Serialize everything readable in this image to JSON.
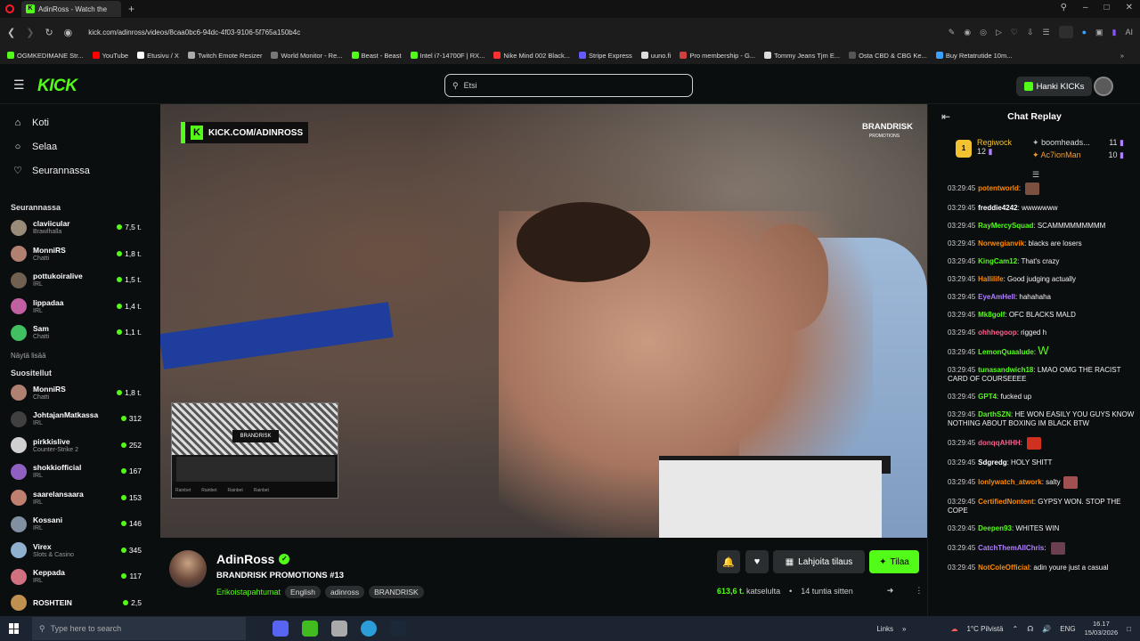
{
  "browser": {
    "tab_title": "AdinRoss - Watch the",
    "url": "kick.com/adinross/videos/8caa0bc6-94dc-4f03-9106-5f765a150b4c",
    "toolbar_ai": "AI",
    "bookmarks": [
      {
        "label": "OGMKEDIMANE Str...",
        "color": "#53fc18"
      },
      {
        "label": "YouTube",
        "color": "#ff0000"
      },
      {
        "label": "Etusivu / X",
        "color": "#ffffff"
      },
      {
        "label": "Twitch Emote Resizer",
        "color": "#aaaaaa"
      },
      {
        "label": "World Monitor - Re...",
        "color": "#777777"
      },
      {
        "label": "Beast - Beast",
        "color": "#53fc18"
      },
      {
        "label": "Intel i7-14700F | RX...",
        "color": "#53fc18"
      },
      {
        "label": "Nike Mind 002 Black...",
        "color": "#ff3030"
      },
      {
        "label": "Stripe Express",
        "color": "#635bff"
      },
      {
        "label": "uuno.fi",
        "color": "#dddddd"
      },
      {
        "label": "Pro membership - G...",
        "color": "#d04040"
      },
      {
        "label": "Tommy Jeans Tjm E...",
        "color": "#dddddd"
      },
      {
        "label": "Osta CBD & CBG Ke...",
        "color": "#555555"
      },
      {
        "label": "Buy Retatrutide 10m...",
        "color": "#3ca0ff"
      }
    ]
  },
  "header": {
    "logo": "KICK",
    "search_placeholder": "Etsi",
    "get_kicks": "Hanki KICKs"
  },
  "sidebar": {
    "nav": [
      {
        "label": "Koti",
        "icon": "home-icon"
      },
      {
        "label": "Selaa",
        "icon": "compass-icon"
      },
      {
        "label": "Seurannassa",
        "icon": "heart-icon"
      }
    ],
    "following_title": "Seurannassa",
    "following": [
      {
        "name": "claviicular",
        "game": "Brawlhalla",
        "viewers": "7,5 t.",
        "color": "#9a8a7a"
      },
      {
        "name": "MonniRS",
        "game": "Chatti",
        "viewers": "1,8 t.",
        "color": "#b08070"
      },
      {
        "name": "pottukoiralive",
        "game": "IRL",
        "viewers": "1,5 t.",
        "color": "#706050"
      },
      {
        "name": "lippadaa",
        "game": "IRL",
        "viewers": "1,4 t.",
        "color": "#c060a0"
      },
      {
        "name": "Sam",
        "game": "Chatti",
        "viewers": "1,1 t.",
        "color": "#40c060"
      }
    ],
    "show_more": "Näytä lisää",
    "recommended_title": "Suositellut",
    "recommended": [
      {
        "name": "MonniRS",
        "game": "Chatti",
        "viewers": "1,8 t.",
        "color": "#b08070"
      },
      {
        "name": "JohtajanMatkassa",
        "game": "IRL",
        "viewers": "312",
        "color": "#404040"
      },
      {
        "name": "pirkkislive",
        "game": "Counter-Strike 2",
        "viewers": "252",
        "color": "#d0d0d0"
      },
      {
        "name": "shokkiofficial",
        "game": "IRL",
        "viewers": "167",
        "color": "#9060c0"
      },
      {
        "name": "saarelansaara",
        "game": "IRL",
        "viewers": "153",
        "color": "#c08070"
      },
      {
        "name": "Kossani",
        "game": "IRL",
        "viewers": "146",
        "color": "#8090a0"
      },
      {
        "name": "Virex",
        "game": "Slots & Casino",
        "viewers": "345",
        "color": "#90b0d0"
      },
      {
        "name": "Keppada",
        "game": "IRL",
        "viewers": "117",
        "color": "#d07080"
      },
      {
        "name": "ROSHTEIN",
        "game": "",
        "viewers": "2,5",
        "color": "#c09050"
      }
    ]
  },
  "video": {
    "overlay_channel": "KICK.COM/ADINROSS",
    "overlay_brand": "BRANDRISK",
    "overlay_brand_sub": "PROMOTIONS",
    "pip_title": "BRANDRISK",
    "pip_sponsor": "Rainbet"
  },
  "stream": {
    "streamer": "AdinRoss",
    "title": "BRANDRISK PROMOTIONS #13",
    "category": "Erikoistapahtumat",
    "tags": [
      "English",
      "adinross",
      "BRANDRISK"
    ],
    "gift_sub": "Lahjoita tilaus",
    "subscribe": "Tilaa",
    "views": "613,6 t.",
    "views_label": "katselulta",
    "time_ago": "14 tuntia sitten"
  },
  "chat": {
    "title": "Chat Replay",
    "top_gifters": [
      {
        "name": "Regiwock",
        "count": "12"
      },
      {
        "name": "boomheads...",
        "count": "11"
      },
      {
        "name": "Ac7ionMan",
        "count": "10"
      }
    ],
    "messages": [
      {
        "time": "03:29:45",
        "user": "potentworld",
        "color": "#ff8a00",
        "text": "",
        "emote": "#7a5040"
      },
      {
        "time": "03:29:45",
        "user": "freddie4242",
        "color": "#ffffff",
        "text": "wwwwwww"
      },
      {
        "time": "03:29:45",
        "user": "RayMercySquad",
        "color": "#53fc18",
        "text": "SCAMMMMMMMMM"
      },
      {
        "time": "03:29:45",
        "user": "Norwegianvik",
        "color": "#ff8a00",
        "text": "blacks are losers"
      },
      {
        "time": "03:29:45",
        "user": "KingCam12",
        "color": "#53fc18",
        "text": "That's crazy"
      },
      {
        "time": "03:29:45",
        "user": "Hallilife",
        "color": "#ff8a00",
        "text": "Good judging actually"
      },
      {
        "time": "03:29:45",
        "user": "EyeAmHell",
        "color": "#b080ff",
        "text": "hahahaha"
      },
      {
        "time": "03:29:45",
        "user": "Mk8golf",
        "color": "#53fc18",
        "text": "OFC BLACKS MALD"
      },
      {
        "time": "03:29:45",
        "user": "ohhhegoop",
        "color": "#ff5c8a",
        "text": "rigged h"
      },
      {
        "time": "03:29:45",
        "user": "LemonQuaalude",
        "color": "#53fc18",
        "text": "W"
      },
      {
        "time": "03:29:45",
        "user": "tunasandwich18",
        "color": "#53fc18",
        "text": "LMAO OMG THE RACIST CARD OF COURSEEEE"
      },
      {
        "time": "03:29:45",
        "user": "GPT4",
        "color": "#53fc18",
        "text": "fucked up"
      },
      {
        "time": "03:29:45",
        "user": "DarthSZN",
        "color": "#53fc18",
        "text": "HE WON EASILY YOU GUYS KNOW NOTHING ABOUT BOXING IM BLACK BTW"
      },
      {
        "time": "03:29:45",
        "user": "donqqAHHH",
        "color": "#ff5c8a",
        "text": "",
        "emote": "#d03020"
      },
      {
        "time": "03:29:45",
        "user": "Sdgredg",
        "color": "#ffffff",
        "text": "HOLY SHITT"
      },
      {
        "time": "03:29:45",
        "user": "lonlywatch_atwork",
        "color": "#ff8a00",
        "text": "salty",
        "emote": "#a05050"
      },
      {
        "time": "03:29:45",
        "user": "CertifiedNontent",
        "color": "#ff8a00",
        "text": "GYPSY WON. STOP THE COPE"
      },
      {
        "time": "03:29:45",
        "user": "Deepen93",
        "color": "#53fc18",
        "text": "WHITES WIN"
      },
      {
        "time": "03:29:45",
        "user": "CatchThemAllChris",
        "color": "#b080ff",
        "text": "",
        "emote": "#6a4050"
      },
      {
        "time": "03:29:45",
        "user": "NotColeOfficial",
        "color": "#ff8a00",
        "text": "adin youre just a casual"
      }
    ]
  },
  "taskbar": {
    "search_placeholder": "Type here to search",
    "links": "Links",
    "weather": "1°C Pilvistä",
    "lang": "ENG",
    "time": "16.17",
    "date": "15/03/2026"
  }
}
